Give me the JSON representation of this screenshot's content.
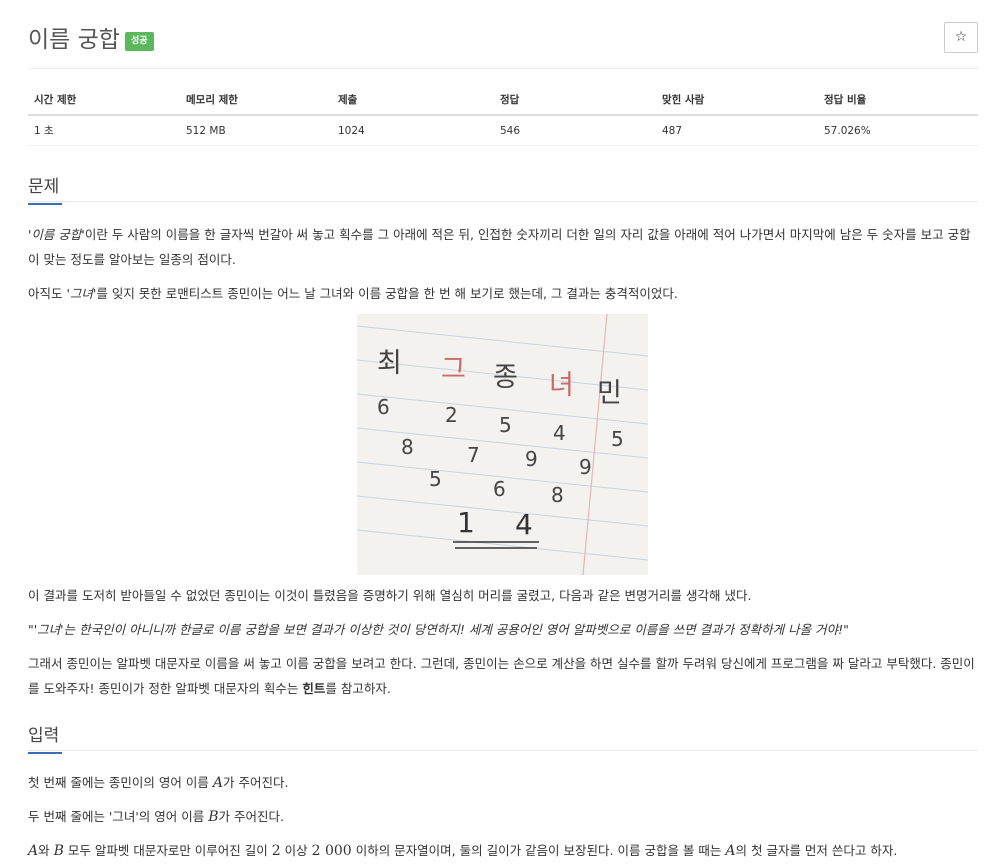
{
  "header": {
    "title": "이름 궁합",
    "badge": "성공",
    "star_icon": "☆"
  },
  "stats": {
    "headers": [
      "시간 제한",
      "메모리 제한",
      "제출",
      "정답",
      "맞힌 사람",
      "정답 비율"
    ],
    "values": [
      "1 초",
      "512 MB",
      "1024",
      "546",
      "487",
      "57.026%"
    ]
  },
  "problem": {
    "heading": "문제",
    "p1_em": "'이름 궁합'",
    "p1_rest": "이란 두 사람의 이름을 한 글자씩 번갈아 써 놓고 획수를 그 아래에 적은 뒤, 인접한 숫자끼리 더한 일의 자리 값을 아래에 적어 나가면서 마지막에 남은 두 숫자를 보고 궁합이 맞는 정도를 알아보는 일종의 점이다.",
    "p2_a": "아직도 ",
    "p2_em": "'그녀'",
    "p2_b": "를 잊지 못한 로맨티스트 종민이는 어느 날 그녀와 이름 궁합을 한 번 해 보기로 했는데, 그 결과는 충격적이었다.",
    "figure": {
      "row0": [
        "최",
        "그",
        "종",
        "녀",
        "민"
      ],
      "row1": [
        "6",
        "2",
        "5",
        "4",
        "5"
      ],
      "row2": [
        "8",
        "7",
        "9",
        "9"
      ],
      "row3": [
        "5",
        "6",
        "8"
      ],
      "row4": [
        "1",
        "4"
      ]
    },
    "p3": "이 결과를 도저히 받아들일 수 없었던 종민이는 이것이 틀렸음을 증명하기 위해 열심히 머리를 굴렸고, 다음과 같은 변명거리를 생각해 냈다.",
    "p4": "\"'그녀'는 한국인이 아니니까 한글로 이름 궁합을 보면 결과가 이상한 것이 당연하지! 세계 공용어인 영어 알파벳으로 이름을 쓰면 결과가 정확하게 나올 거야!\"",
    "p5_a": "그래서 종민이는 알파벳 대문자로 이름을 써 놓고 이름 궁합을 보려고 한다. 그런데, 종민이는 손으로 계산을 하면 실수를 할까 두려워 당신에게 프로그램을 짜 달라고 부탁했다. 종민이를 도와주자! 종민이가 정한 알파벳 대문자의 획수는 ",
    "p5_bold": "힌트",
    "p5_b": "를 참고하자."
  },
  "input": {
    "heading": "입력",
    "l1_a": "첫 번째 줄에는 종민이의 영어 이름 ",
    "l1_var": "A",
    "l1_b": "가 주어진다.",
    "l2_a": "두 번째 줄에는 '그녀'의 영어 이름 ",
    "l2_var": "B",
    "l2_b": "가 주어진다.",
    "l3_var1": "A",
    "l3_a": "와 ",
    "l3_var2": "B",
    "l3_b": " 모두 알파벳 대문자로만 이루어진 길이 ",
    "l3_n1": "2",
    "l3_c": " 이상 ",
    "l3_n2": "2 000",
    "l3_d": " 이하의 문자열이며, 둘의 길이가 같음이 보장된다. 이름 궁합을 볼 때는 ",
    "l3_var3": "A",
    "l3_e": "의 첫 글자를 먼저 쓴다고 하자."
  }
}
